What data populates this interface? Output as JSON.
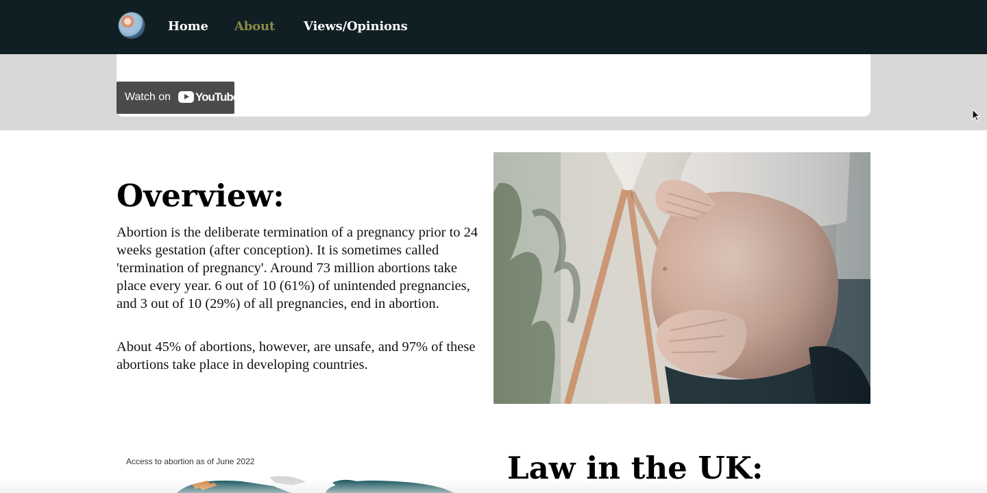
{
  "navbar": {
    "logo_icon": "fetus-globe-logo-icon",
    "items": [
      {
        "label": "Home",
        "active": false
      },
      {
        "label": "About",
        "active": true
      },
      {
        "label": "Views/Opinions",
        "active": false
      }
    ],
    "background": "#0f1f24",
    "active_color": "#8b8a48"
  },
  "video": {
    "watch_label": "Watch on",
    "brand_label": "YouTube",
    "play_icon": "youtube-play-icon"
  },
  "overview": {
    "title": "Overview:",
    "paragraph_1": "Abortion is the deliberate termination of a pregnancy prior to 24 weeks gestation (after conception). It is sometimes called 'termination of pregnancy'. Around 73 million abortions take place every year. 6 out of 10 (61%) of unintended pregnancies, and 3 out of 10 (29%) of all pregnancies, end in abortion.",
    "paragraph_2": "About 45% of abortions, however, are unsafe, and 97% of these abortions take place in developing countries.",
    "image_alt": "pregnancy-photo"
  },
  "map_section": {
    "caption": "Access to abortion as of June 2022"
  },
  "law_section": {
    "title": "Law in the UK:"
  },
  "pointer_icon": "mouse-pointer-icon"
}
